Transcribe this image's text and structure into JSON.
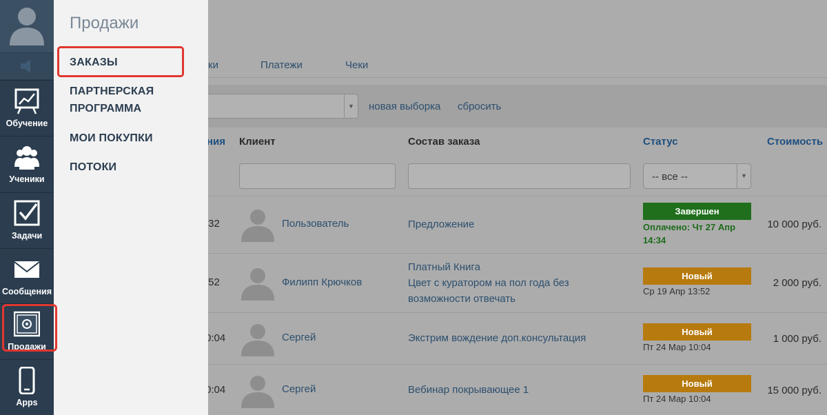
{
  "sidebar": {
    "items": [
      {
        "label": "Обучение",
        "icon": "chart-board-icon"
      },
      {
        "label": "Ученики",
        "icon": "users-icon"
      },
      {
        "label": "Задачи",
        "icon": "checkbox-icon"
      },
      {
        "label": "Сообщения",
        "icon": "envelope-icon"
      },
      {
        "label": "Продажи",
        "icon": "safe-icon"
      },
      {
        "label": "Apps",
        "icon": "phone-icon"
      }
    ]
  },
  "flyout": {
    "title": "Продажи",
    "items": [
      {
        "label": "ЗАКАЗЫ"
      },
      {
        "label_line1": "ПАРТНЕРСКАЯ",
        "label_line2": "ПРОГРАММА"
      },
      {
        "label": "МОИ ПОКУПКИ"
      },
      {
        "label": "ПОТОКИ"
      }
    ]
  },
  "tabs": {
    "partial": "ки",
    "payments": "Платежи",
    "receipts": "Чеки"
  },
  "filter": {
    "new_selection": "новая выборка",
    "reset": "сбросить"
  },
  "table": {
    "headers": {
      "date_partial": "ния",
      "client": "Клиент",
      "order": "Состав заказа",
      "status": "Статус",
      "cost": "Стоимость"
    },
    "status_filter": "-- все --",
    "rows": [
      {
        "time": ":32",
        "client": "Пользователь",
        "order_lines": [
          "Предложение"
        ],
        "status": "Завершен",
        "note": "Оплачено: Чт 27 Апр 14:34",
        "price": "10 000 руб."
      },
      {
        "time": ":52",
        "client": "Филипп Крючков",
        "order_lines": [
          "Платный Книга",
          "Цвет с куратором на пол года без",
          "возможности отвечать"
        ],
        "status": "Новый",
        "note": "Ср 19 Апр 13:52",
        "price": "2 000 руб."
      },
      {
        "time": "0:04",
        "client": "Сергей",
        "order_lines": [
          "Экстрим вождение доп.консультация"
        ],
        "status": "Новый",
        "note": "Пт 24 Мар 10:04",
        "price": "1 000 руб."
      },
      {
        "time": "0:04",
        "client": "Сергей",
        "order_lines": [
          "Вебинар покрывающее 1"
        ],
        "status": "Новый",
        "note": "Пт 24 Мар 10:04",
        "price": "15 000 руб."
      }
    ]
  },
  "colors": {
    "sidebar": "#2b3d4f",
    "highlight": "#e0372f",
    "done": "#1f6f1c",
    "new": "#b77a0e"
  }
}
